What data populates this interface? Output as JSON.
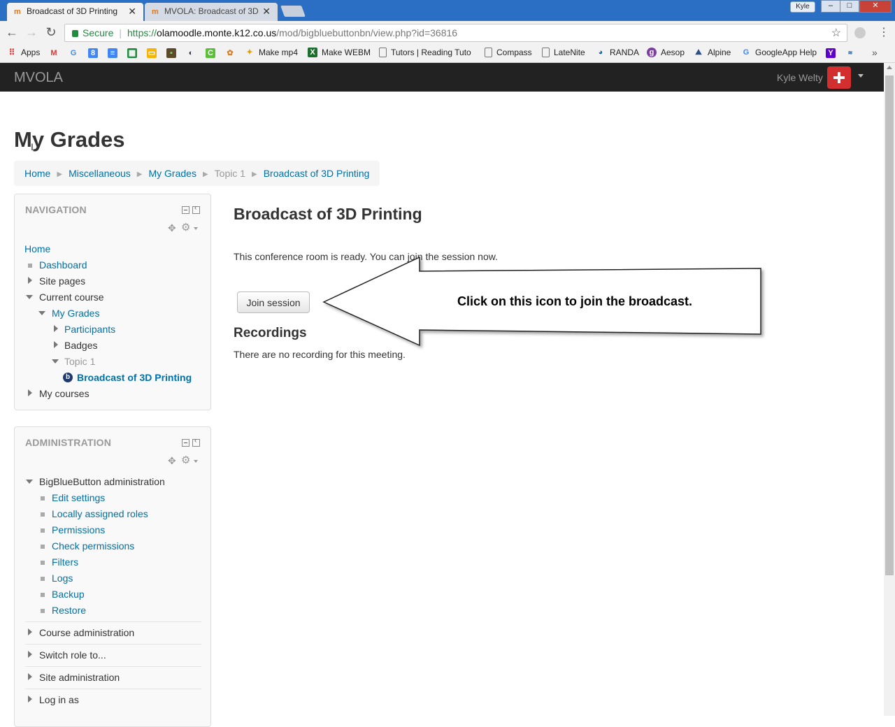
{
  "browser": {
    "tabs": [
      {
        "title": "Broadcast of 3D Printing",
        "active": true
      },
      {
        "title": "MVOLA: Broadcast of 3D",
        "active": false
      }
    ],
    "profile_name": "Kyle",
    "window_buttons": {
      "minimize": "–",
      "maximize": "□",
      "close": "✕"
    },
    "address": {
      "secure_label": "Secure",
      "url_scheme": "https://",
      "url_host": "olamoodle.monte.k12.co.us",
      "url_path": "/mod/bigbluebuttonbn/view.php?id=36816"
    },
    "bookmarks": [
      {
        "label": "Apps",
        "icon": "apps-grid-icon"
      },
      {
        "label": "",
        "icon": "gmail-icon"
      },
      {
        "label": "",
        "icon": "google-icon"
      },
      {
        "label": "",
        "icon": "calendar-icon"
      },
      {
        "label": "",
        "icon": "docs-icon"
      },
      {
        "label": "",
        "icon": "sheets-icon"
      },
      {
        "label": "",
        "icon": "slides-icon"
      },
      {
        "label": "",
        "icon": "minecraft-icon"
      },
      {
        "label": "",
        "icon": "app-icon"
      },
      {
        "label": "",
        "icon": "classroom-icon"
      },
      {
        "label": "",
        "icon": "pattern-icon"
      },
      {
        "label": "Make mp4",
        "icon": "mp4-icon"
      },
      {
        "label": "Make WEBM",
        "icon": "webm-icon"
      },
      {
        "label": "Tutors | Reading Tuto",
        "icon": "page-icon"
      },
      {
        "label": "Compass",
        "icon": "page-icon"
      },
      {
        "label": "LateNite",
        "icon": "page-icon"
      },
      {
        "label": "RANDA",
        "icon": "randa-icon"
      },
      {
        "label": "Aesop",
        "icon": "aesop-icon"
      },
      {
        "label": "Alpine",
        "icon": "alpine-icon"
      },
      {
        "label": "GoogleApp Help",
        "icon": "google-icon"
      },
      {
        "label": "",
        "icon": "yahoo-icon"
      },
      {
        "label": "",
        "icon": "sxm-icon"
      }
    ],
    "bookmarks_overflow": "»"
  },
  "site": {
    "brand": "MVOLA",
    "user_name": "Kyle Welty"
  },
  "page": {
    "title": "My Grades",
    "breadcrumb": [
      {
        "label": "Home",
        "link": true
      },
      {
        "label": "Miscellaneous",
        "link": true
      },
      {
        "label": "My Grades",
        "link": true
      },
      {
        "label": "Topic 1",
        "link": false
      },
      {
        "label": "Broadcast of 3D Printing",
        "link": true
      }
    ],
    "breadcrumb_separator": "▶"
  },
  "navigation_block": {
    "title": "NAVIGATION",
    "items": [
      {
        "label": "Home"
      },
      {
        "label": "Dashboard"
      },
      {
        "label": "Site pages"
      },
      {
        "label": "Current course"
      },
      {
        "label": "My Grades"
      },
      {
        "label": "Participants"
      },
      {
        "label": "Badges"
      },
      {
        "label": "Topic 1"
      },
      {
        "label": "Broadcast of 3D Printing"
      },
      {
        "label": "My courses"
      }
    ]
  },
  "administration_block": {
    "title": "ADMINISTRATION",
    "section": "BigBlueButton administration",
    "items": [
      {
        "label": "Edit settings"
      },
      {
        "label": "Locally assigned roles"
      },
      {
        "label": "Permissions"
      },
      {
        "label": "Check permissions"
      },
      {
        "label": "Filters"
      },
      {
        "label": "Logs"
      },
      {
        "label": "Backup"
      },
      {
        "label": "Restore"
      }
    ],
    "collapsed_sections": [
      {
        "label": "Course administration"
      },
      {
        "label": "Switch role to..."
      },
      {
        "label": "Site administration"
      },
      {
        "label": "Log in as"
      }
    ]
  },
  "main": {
    "heading": "Broadcast of 3D Printing",
    "ready_text": "This conference room is ready. You can join the session now.",
    "join_button": "Join session",
    "recordings_heading": "Recordings",
    "no_recordings_text": "There are no recording for this meeting.",
    "callout_text": "Click on this icon to join the broadcast."
  },
  "colors": {
    "link": "#0070a8",
    "navbar": "#222222",
    "tabstrip": "#2a6fc4",
    "secure": "#1e8e3e"
  }
}
